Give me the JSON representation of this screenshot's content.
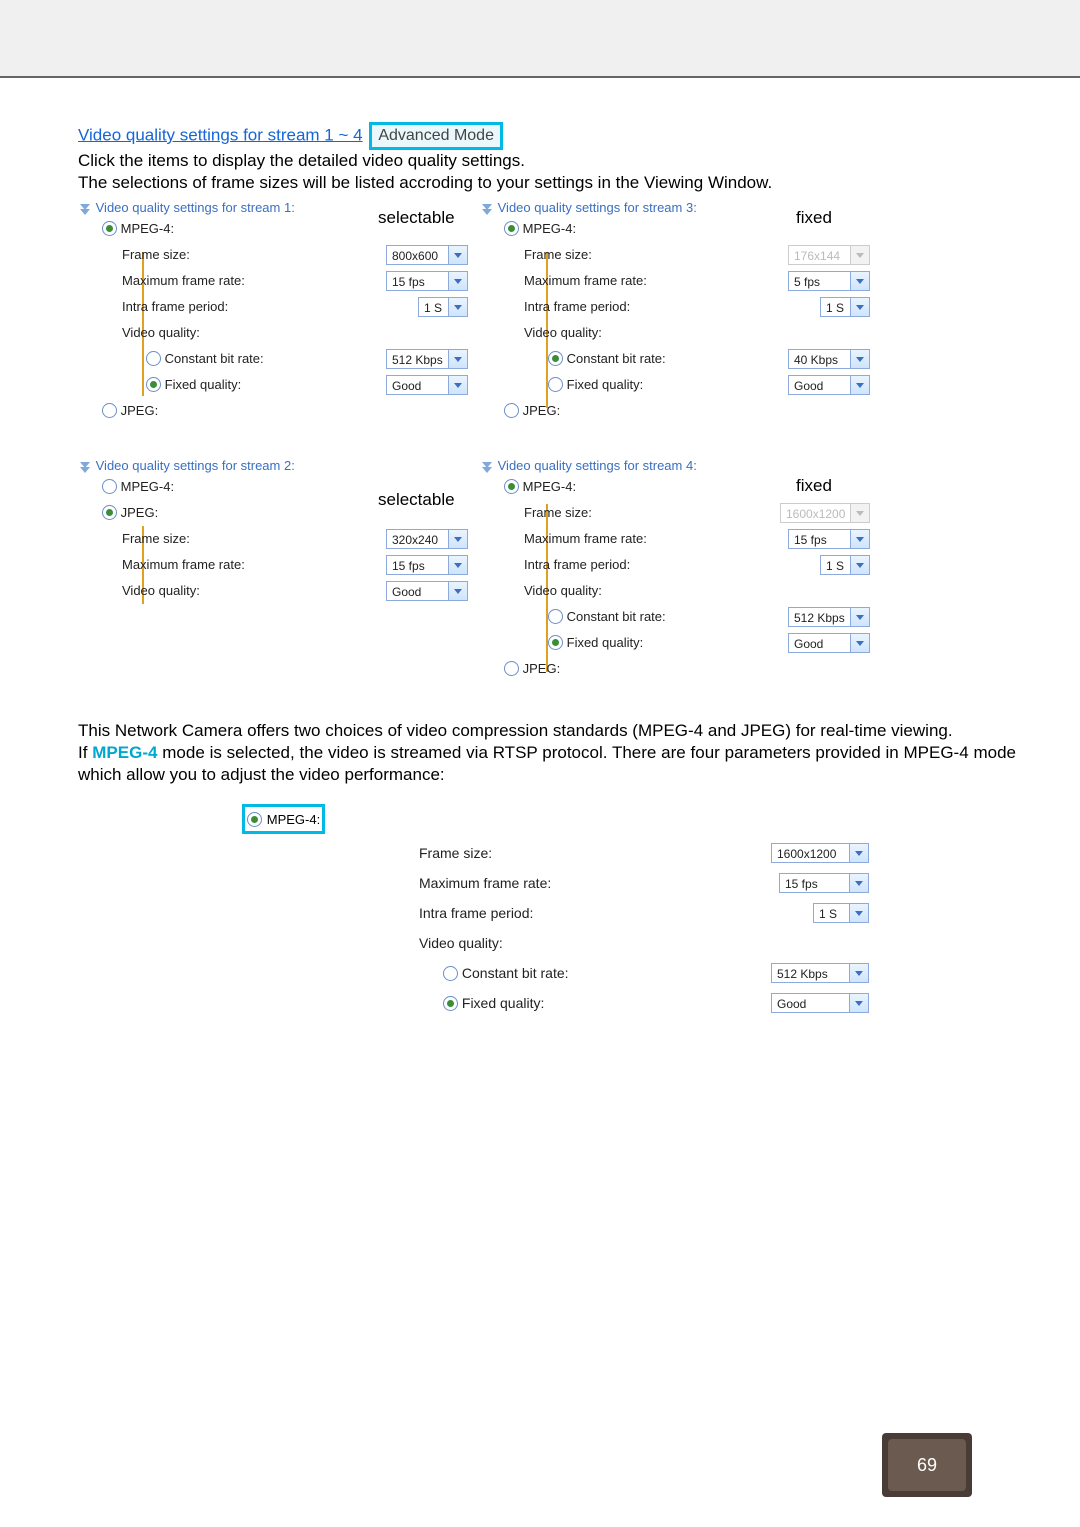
{
  "heading": {
    "link": "Video quality settings for stream 1 ~ 4",
    "badge": "Advanced Mode",
    "line1": "Click the items to display the detailed video quality settings.",
    "line2": "The selections of frame sizes will be listed accroding to your settings in the Viewing Window."
  },
  "notes": {
    "selectable": "selectable",
    "fixed": "fixed"
  },
  "labels": {
    "mpeg4": "MPEG-4:",
    "jpeg": "JPEG:",
    "frame_size": "Frame size:",
    "max_rate": "Maximum frame rate:",
    "intra": "Intra frame period:",
    "vq": "Video quality:",
    "cbr": "Constant bit rate:",
    "fixedq": "Fixed quality:"
  },
  "streams": {
    "s1": {
      "title": "Video quality settings for stream 1:",
      "frame": "800x600",
      "rate": "15 fps",
      "intra": "1 S",
      "cbr": "512 Kbps",
      "fixedq": "Good"
    },
    "s2": {
      "title": "Video quality settings for stream 2:",
      "frame": "320x240",
      "rate": "15 fps",
      "vq": "Good"
    },
    "s3": {
      "title": "Video quality settings for stream 3:",
      "frame": "176x144",
      "rate": "5 fps",
      "intra": "1 S",
      "cbr": "40 Kbps",
      "fixedq": "Good"
    },
    "s4": {
      "title": "Video quality settings for stream 4:",
      "frame": "1600x1200",
      "rate": "15 fps",
      "intra": "1 S",
      "cbr": "512 Kbps",
      "fixedq": "Good"
    }
  },
  "para": {
    "p1": "This Network Camera offers two choices of video compression standards (MPEG-4 and JPEG) for real-time viewing.",
    "p2a": "If ",
    "mpeg": "MPEG-4",
    "p2b": " mode is selected, the video is streamed via RTSP protocol. There are four parameters provided in MPEG-4 mode which allow you to adjust the video performance:"
  },
  "set2": {
    "frame": "1600x1200",
    "rate": "15 fps",
    "intra": "1 S",
    "cbr": "512 Kbps",
    "fixedq": "Good"
  },
  "pagenum": "69"
}
